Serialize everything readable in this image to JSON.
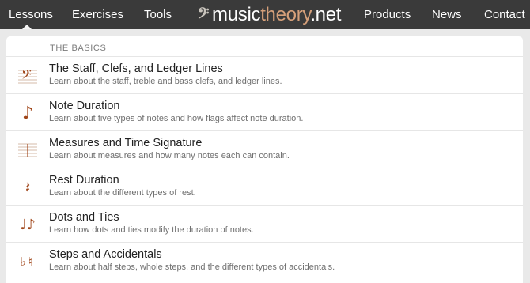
{
  "nav": {
    "lessons": "Lessons",
    "exercises": "Exercises",
    "tools": "Tools",
    "products": "Products",
    "news": "News",
    "contact": "Contact",
    "active": "Lessons"
  },
  "logo": {
    "icon": "bass-clef-logo-icon",
    "glyph": "𝄢",
    "part1": "music",
    "part2": "theory",
    "part3": ".net"
  },
  "section": {
    "title": "THE BASICS"
  },
  "lessons": [
    {
      "icon": "bass-clef-staff-icon",
      "glyph": "𝄢",
      "title": "The Staff, Clefs, and Ledger Lines",
      "description": "Learn about the staff, treble and bass clefs, and ledger lines."
    },
    {
      "icon": "eighth-note-icon",
      "glyph": "♪",
      "title": "Note Duration",
      "description": "Learn about five types of notes and how flags affect note duration."
    },
    {
      "icon": "time-signature-staff-icon",
      "glyph": "",
      "title": "Measures and Time Signature",
      "description": "Learn about measures and how many notes each can contain."
    },
    {
      "icon": "quarter-rest-icon",
      "glyph": "𝄽",
      "title": "Rest Duration",
      "description": "Learn about the different types of rest."
    },
    {
      "icon": "tied-notes-icon",
      "glyph": "♩♪",
      "title": "Dots and Ties",
      "description": "Learn how dots and ties modify the duration of notes."
    },
    {
      "icon": "flat-natural-icon",
      "glyph": "♭♮",
      "title": "Steps and Accidentals",
      "description": "Learn about half steps, whole steps, and the different types of accidentals."
    }
  ],
  "colors": {
    "navbar": "#3a3a3a",
    "accent": "#a0461a",
    "logo_theory": "#d6a07a"
  }
}
